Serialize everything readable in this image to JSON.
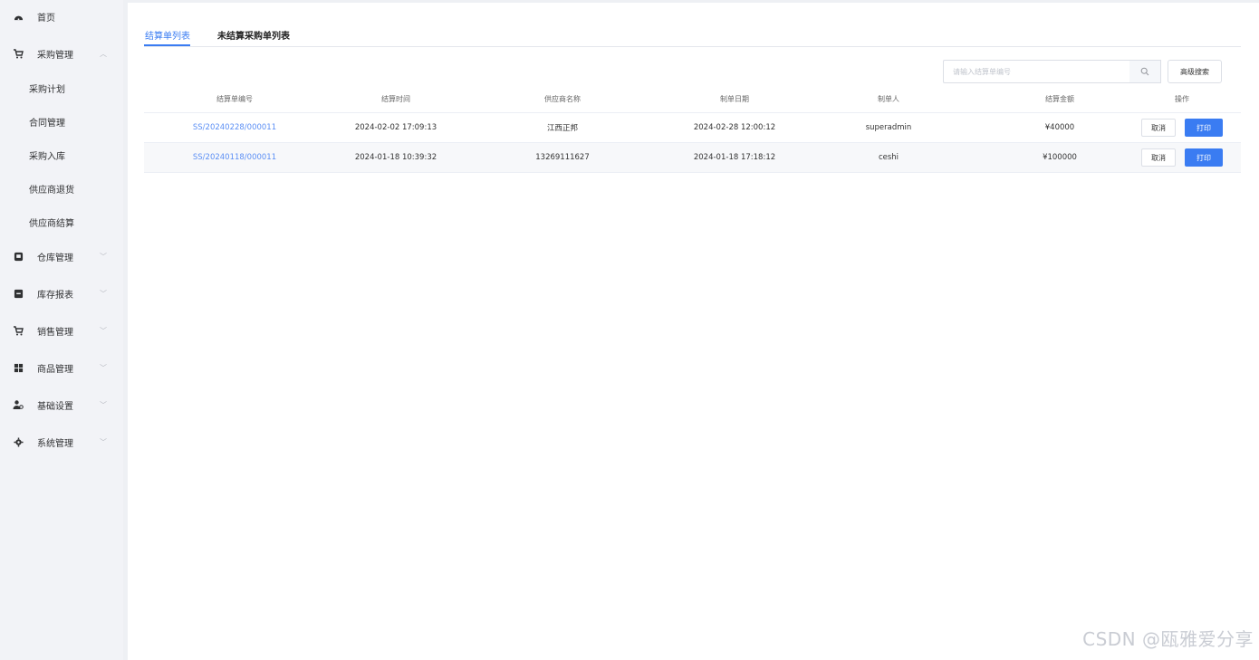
{
  "sidebar": {
    "items": [
      {
        "label": "首页",
        "icon": "dashboard-icon"
      },
      {
        "label": "采购管理",
        "icon": "cart-icon",
        "expanded": true,
        "children": [
          "采购计划",
          "合同管理",
          "采购入库",
          "供应商退货",
          "供应商结算"
        ]
      },
      {
        "label": "仓库管理",
        "icon": "warehouse-icon"
      },
      {
        "label": "库存报表",
        "icon": "report-icon"
      },
      {
        "label": "销售管理",
        "icon": "sales-cart-icon"
      },
      {
        "label": "商品管理",
        "icon": "grid-icon"
      },
      {
        "label": "基础设置",
        "icon": "users-icon"
      },
      {
        "label": "系统管理",
        "icon": "gear-icon"
      }
    ]
  },
  "tabs": [
    {
      "label": "结算单列表",
      "active": true
    },
    {
      "label": "未结算采购单列表",
      "active": false
    }
  ],
  "search": {
    "placeholder": "请输入结算单编号",
    "advanced_label": "高级搜索"
  },
  "table": {
    "columns": [
      "结算单编号",
      "结算时间",
      "供应商名称",
      "制单日期",
      "制单人",
      "结算金额",
      "操作"
    ],
    "rows": [
      {
        "id": "SS/20240228/000011",
        "time": "2024-02-02 17:09:13",
        "supplier": "江西正邦",
        "created": "2024-02-28 12:00:12",
        "maker": "superadmin",
        "amount": "¥40000",
        "cancel": "取消",
        "print": "打印"
      },
      {
        "id": "SS/20240118/000011",
        "time": "2024-01-18 10:39:32",
        "supplier": "13269111627",
        "created": "2024-01-18 17:18:12",
        "maker": "ceshi",
        "amount": "¥100000",
        "cancel": "取消",
        "print": "打印"
      }
    ]
  },
  "watermark": "CSDN @瓯雅爱分享",
  "colors": {
    "accent": "#3a7cf2",
    "link": "#5b8ff5",
    "sidebar_bg": "#f2f3f7"
  }
}
